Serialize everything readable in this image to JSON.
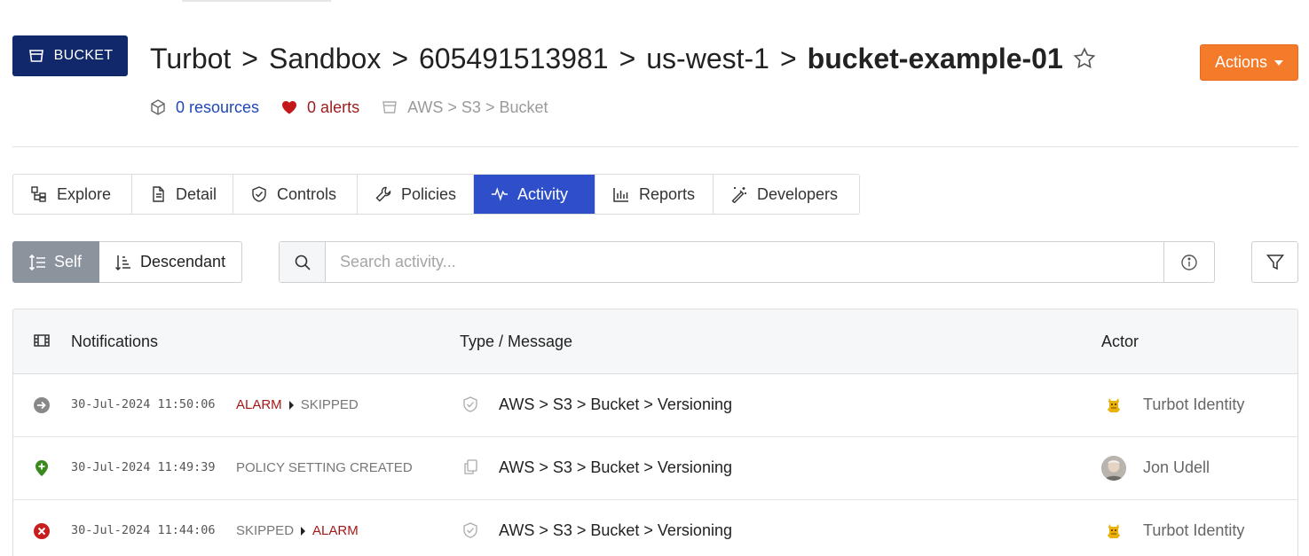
{
  "header": {
    "type_badge": "BUCKET",
    "breadcrumbs": [
      "Turbot",
      "Sandbox",
      "605491513981",
      "us-west-1"
    ],
    "separator": ">",
    "current": "bucket-example-01",
    "actions_label": "Actions"
  },
  "meta": {
    "resources": "0 resources",
    "alerts": "0 alerts",
    "resource_type": "AWS > S3 > Bucket"
  },
  "tabs": [
    {
      "label": "Explore",
      "icon": "explore-icon"
    },
    {
      "label": "Detail",
      "icon": "document-icon"
    },
    {
      "label": "Controls",
      "icon": "shield-check-icon"
    },
    {
      "label": "Policies",
      "icon": "wrench-icon"
    },
    {
      "label": "Activity",
      "icon": "pulse-icon",
      "active": true
    },
    {
      "label": "Reports",
      "icon": "bar-chart-icon"
    },
    {
      "label": "Developers",
      "icon": "magic-wand-icon"
    }
  ],
  "scope": {
    "self_label": "Self",
    "descendant_label": "Descendant"
  },
  "search": {
    "placeholder": "Search activity..."
  },
  "table": {
    "columns": [
      "Notifications",
      "Type / Message",
      "Actor"
    ],
    "rows": [
      {
        "status_icon": "arrow-circle-right-icon",
        "timestamp": "30-Jul-2024 11:50:06",
        "from": "ALARM",
        "to": "SKIPPED",
        "type_icon": "shield-check-icon",
        "message": "AWS > S3 > Bucket > Versioning",
        "actor": "Turbot Identity"
      },
      {
        "status_icon": "plus-circle-icon",
        "timestamp": "30-Jul-2024 11:49:39",
        "from": "POLICY SETTING CREATED",
        "to": "",
        "type_icon": "copy-icon",
        "message": "AWS > S3 > Bucket > Versioning",
        "actor": "Jon Udell"
      },
      {
        "status_icon": "x-circle-icon",
        "timestamp": "30-Jul-2024 11:44:06",
        "from": "SKIPPED",
        "to": "ALARM",
        "type_icon": "shield-check-icon",
        "message": "AWS > S3 > Bucket > Versioning",
        "actor": "Turbot Identity"
      }
    ]
  },
  "colors": {
    "badge": "#11296b",
    "actions": "#f47b2a",
    "active_tab": "#2f4ec9",
    "link": "#1f47b8",
    "alarm": "#a31919",
    "ok_green": "#3a8a1e",
    "error_red": "#c81e1e",
    "neutral": "#888888"
  }
}
